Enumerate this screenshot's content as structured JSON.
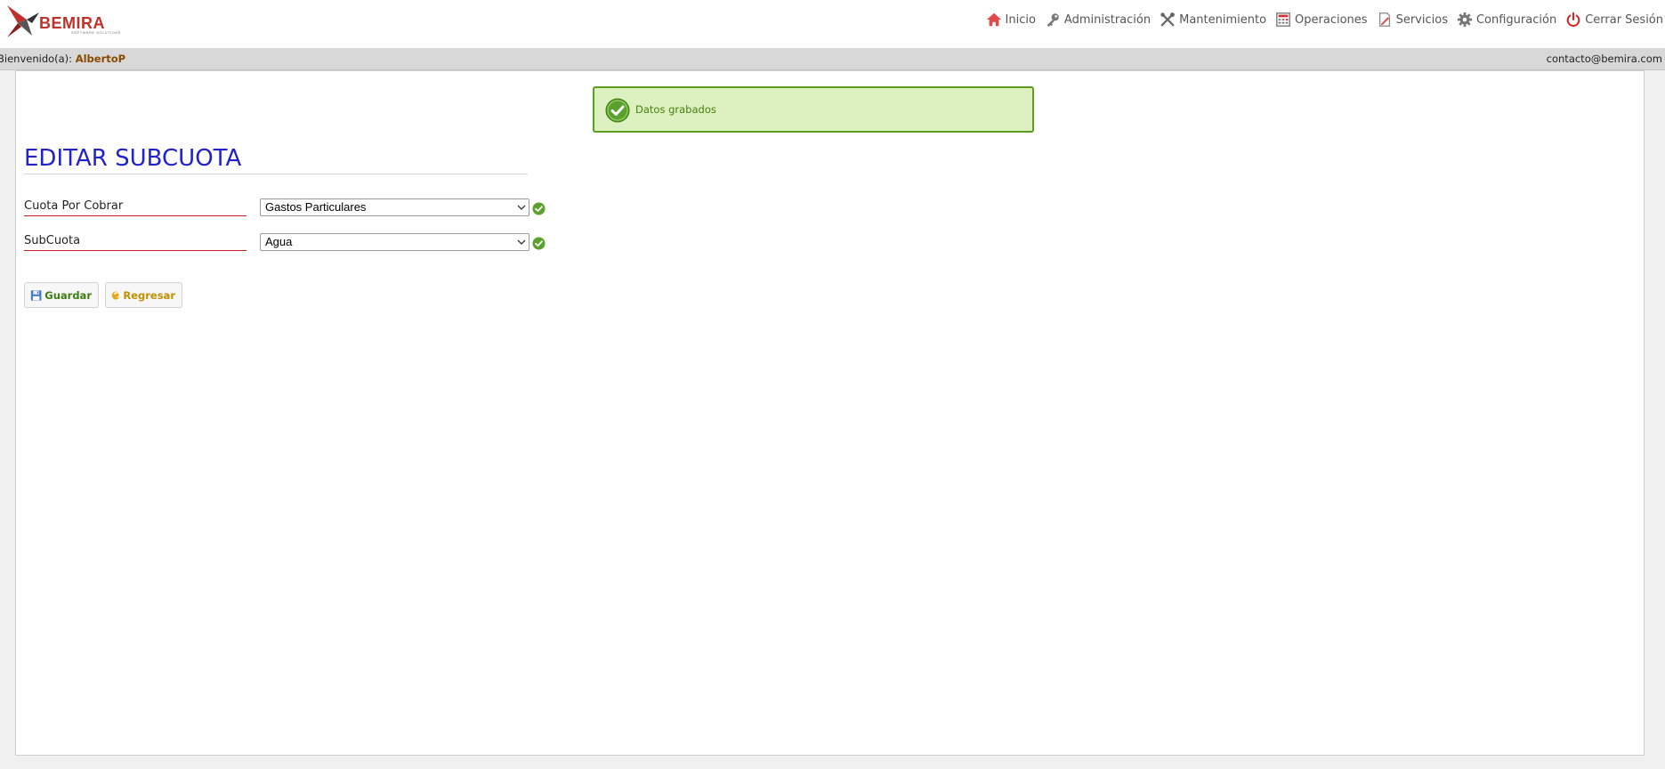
{
  "brand": {
    "name": "BEMIRA",
    "tagline": "SOFTWARE SOLUTIONS"
  },
  "nav": {
    "items": [
      {
        "label": "Inicio",
        "icon": "home-icon"
      },
      {
        "label": "Administración",
        "icon": "key-icon"
      },
      {
        "label": "Mantenimiento",
        "icon": "tools-icon"
      },
      {
        "label": "Operaciones",
        "icon": "calculator-icon"
      },
      {
        "label": "Servicios",
        "icon": "document-edit-icon"
      },
      {
        "label": "Configuración",
        "icon": "gear-icon"
      },
      {
        "label": "Cerrar Sesión",
        "icon": "power-icon"
      }
    ]
  },
  "welcome": {
    "prefix": "Bienvenido(a):",
    "user": "AlbertoP",
    "contact": "contacto@bemira.com"
  },
  "alert": {
    "message": "Datos grabados"
  },
  "page": {
    "title": "EDITAR SUBCUOTA"
  },
  "form": {
    "cuota": {
      "label": "Cuota Por Cobrar",
      "value": "Gastos Particulares"
    },
    "subcuota": {
      "label": "SubCuota",
      "value": "Agua"
    }
  },
  "buttons": {
    "save": "Guardar",
    "back": "Regresar"
  },
  "colors": {
    "title": "#2222cc",
    "alert_bg": "#dcf1bf",
    "alert_border": "#5c9c1e",
    "brand": "#c0302a"
  }
}
